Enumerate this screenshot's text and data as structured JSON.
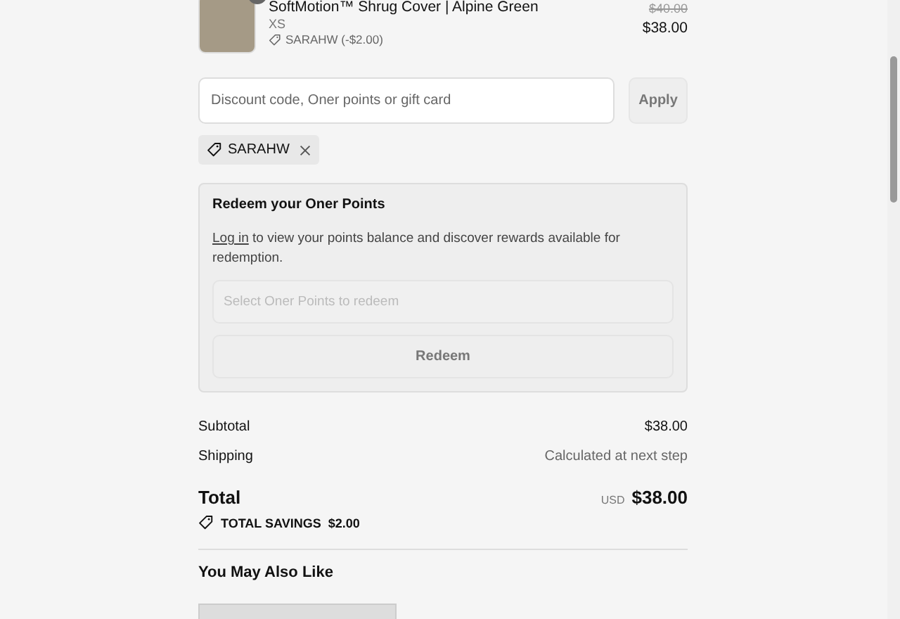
{
  "product": {
    "name": "SoftMotion™ Shrug Cover | Alpine Green",
    "variant": "XS",
    "discount": "SARAHW (-$2.00)",
    "original_price": "$40.00",
    "price": "$38.00"
  },
  "discount_field": {
    "placeholder": "Discount code, Oner points or gift card"
  },
  "apply_button": "Apply",
  "applied_codes": [
    {
      "code": "SARAHW"
    }
  ],
  "redeem": {
    "title": "Redeem your Oner Points",
    "link": "Log in",
    "text": "to view your points balance and discover rewards available for redemption.",
    "select_placeholder": "Select Oner Points to redeem",
    "button": "Redeem",
    "disabled": true
  },
  "summary": {
    "subtotal_label": "Subtotal",
    "subtotal": "$38.00",
    "shipping_label": "Shipping",
    "shipping": "Calculated at next step",
    "total_label": "Total",
    "currency": "USD",
    "total": "$38.00",
    "savings_label": "TOTAL SAVINGS",
    "savings": "$2.00"
  },
  "recommendations": {
    "title": "You May Also Like"
  }
}
